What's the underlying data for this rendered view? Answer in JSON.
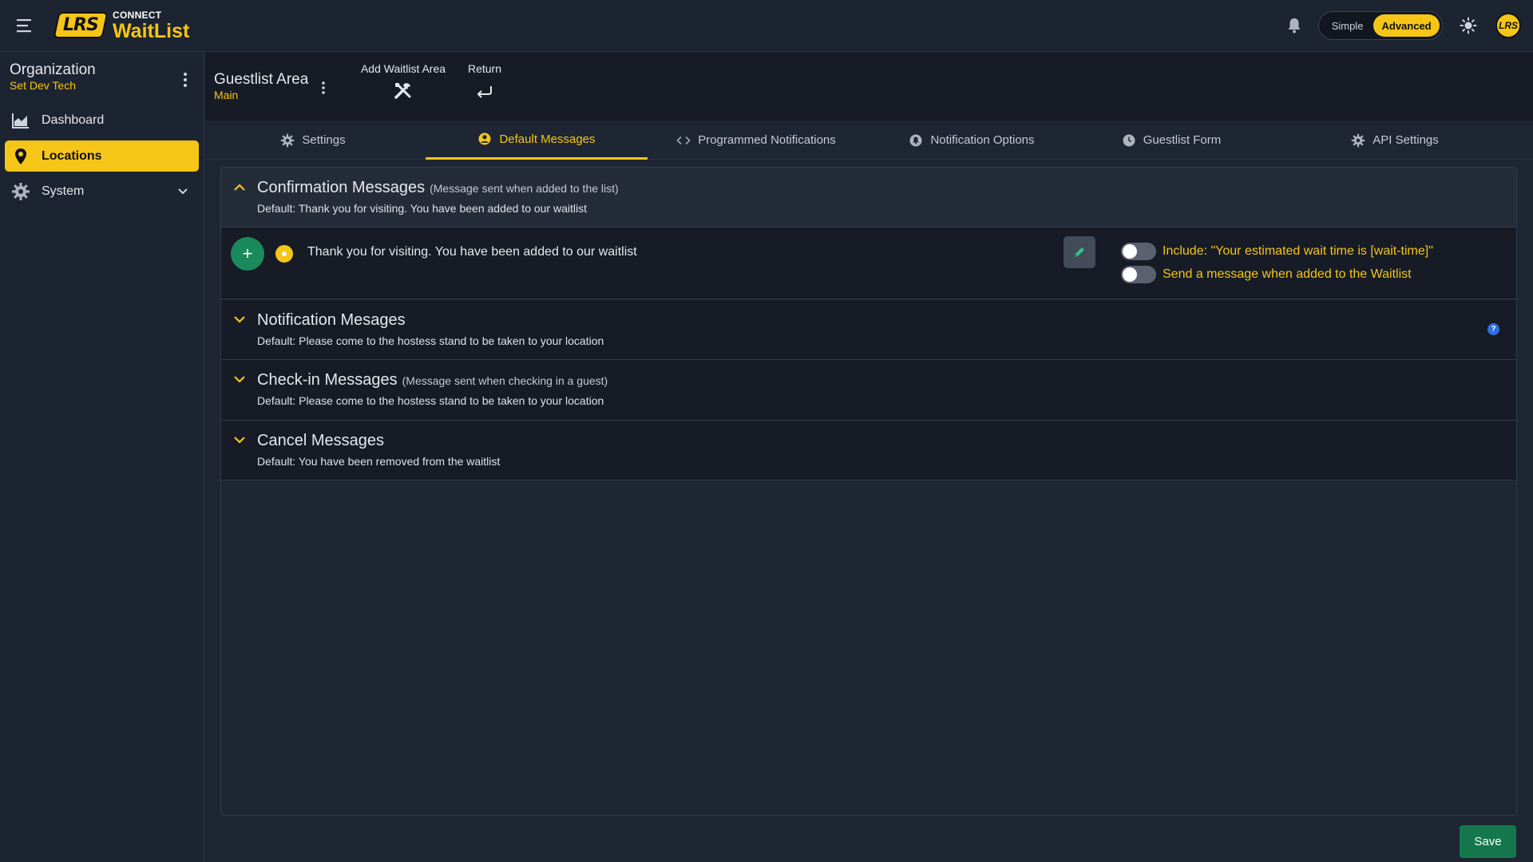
{
  "brand": {
    "logo_text": "LRS",
    "small": "CONNECT",
    "name": "WaitList"
  },
  "topbar": {
    "mode_simple": "Simple",
    "mode_advanced": "Advanced",
    "avatar_text": "LRS"
  },
  "sidebar": {
    "org_title": "Organization",
    "org_sub": "Set Dev Tech",
    "items": [
      {
        "label": "Dashboard",
        "icon": "chart-area-icon"
      },
      {
        "label": "Locations",
        "icon": "map-pin-icon"
      },
      {
        "label": "System",
        "icon": "gear-icon"
      }
    ]
  },
  "header": {
    "title": "Guestlist Area",
    "subtitle": "Main",
    "add_label": "Add Waitlist Area",
    "return_label": "Return"
  },
  "tabs": [
    {
      "label": "Settings",
      "icon": "gear-icon"
    },
    {
      "label": "Default Messages",
      "icon": "user-circle-icon"
    },
    {
      "label": "Programmed Notifications",
      "icon": "code-icon"
    },
    {
      "label": "Notification Options",
      "icon": "bell-circle-icon"
    },
    {
      "label": "Guestlist Form",
      "icon": "clock-icon"
    },
    {
      "label": "API Settings",
      "icon": "gear-icon"
    }
  ],
  "sections": [
    {
      "title": "Confirmation Messages",
      "paren": "(Message sent when added to the list)",
      "default": "Default: Thank you for visiting. You have been added to our waitlist",
      "message": "Thank you for visiting. You have been added to our waitlist",
      "toggle1": "Include: \"Your estimated wait time is [wait-time]\"",
      "toggle2": "Send a message when added to the Waitlist"
    },
    {
      "title": "Notification Mesages",
      "default": "Default: Please come to the hostess stand to be taken to your location",
      "help": "?"
    },
    {
      "title": "Check-in Messages",
      "paren": "(Message sent when checking in a guest)",
      "default": "Default: Please come to the hostess stand to be taken to your location"
    },
    {
      "title": "Cancel Messages",
      "default": "Default: You have been removed from the waitlist"
    }
  ],
  "footer": {
    "save_label": "Save"
  },
  "colors": {
    "accent": "#f5c518",
    "success": "#15784d",
    "bg": "#1f2633",
    "panel": "#161b26"
  }
}
